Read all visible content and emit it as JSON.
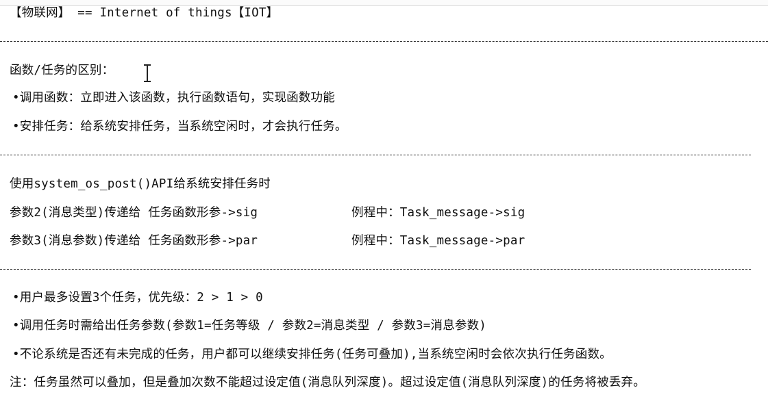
{
  "doc": {
    "title_line": "【物联网】 == Internet of things【IOT】",
    "section1": {
      "heading": "函数/任务的区别：",
      "items": [
        "•调用函数：立即进入该函数，执行函数语句，实现函数功能",
        "•安排任务：给系统安排任务，当系统空闲时，才会执行任务。"
      ]
    },
    "section2": {
      "intro": "使用system_os_post()API给系统安排任务时",
      "rows": [
        {
          "left": "参数2(消息类型)传递给 任务函数形参->sig",
          "right": "例程中：Task_message->sig"
        },
        {
          "left": "参数3(消息参数)传递给 任务函数形参->par",
          "right": "例程中：Task_message->par"
        }
      ]
    },
    "section3": {
      "items": [
        "•用户最多设置3个任务，优先级：2 > 1 > 0",
        "•调用任务时需给出任务参数(参数1=任务等级 / 参数2=消息类型 / 参数3=消息参数)",
        "•不论系统是否还有未完成的任务，用户都可以继续安排任务(任务可叠加),当系统空闲时会依次执行任务函数。"
      ],
      "note": "注：任务虽然可以叠加，但是叠加次数不能超过设定值(消息队列深度)。超过设定值(消息队列深度)的任务将被丢弃。"
    }
  },
  "icons": {
    "cursor": "text-cursor-icon"
  },
  "colors": {
    "text": "#111111",
    "divider": "#2a2a2a",
    "background": "#ffffff"
  }
}
